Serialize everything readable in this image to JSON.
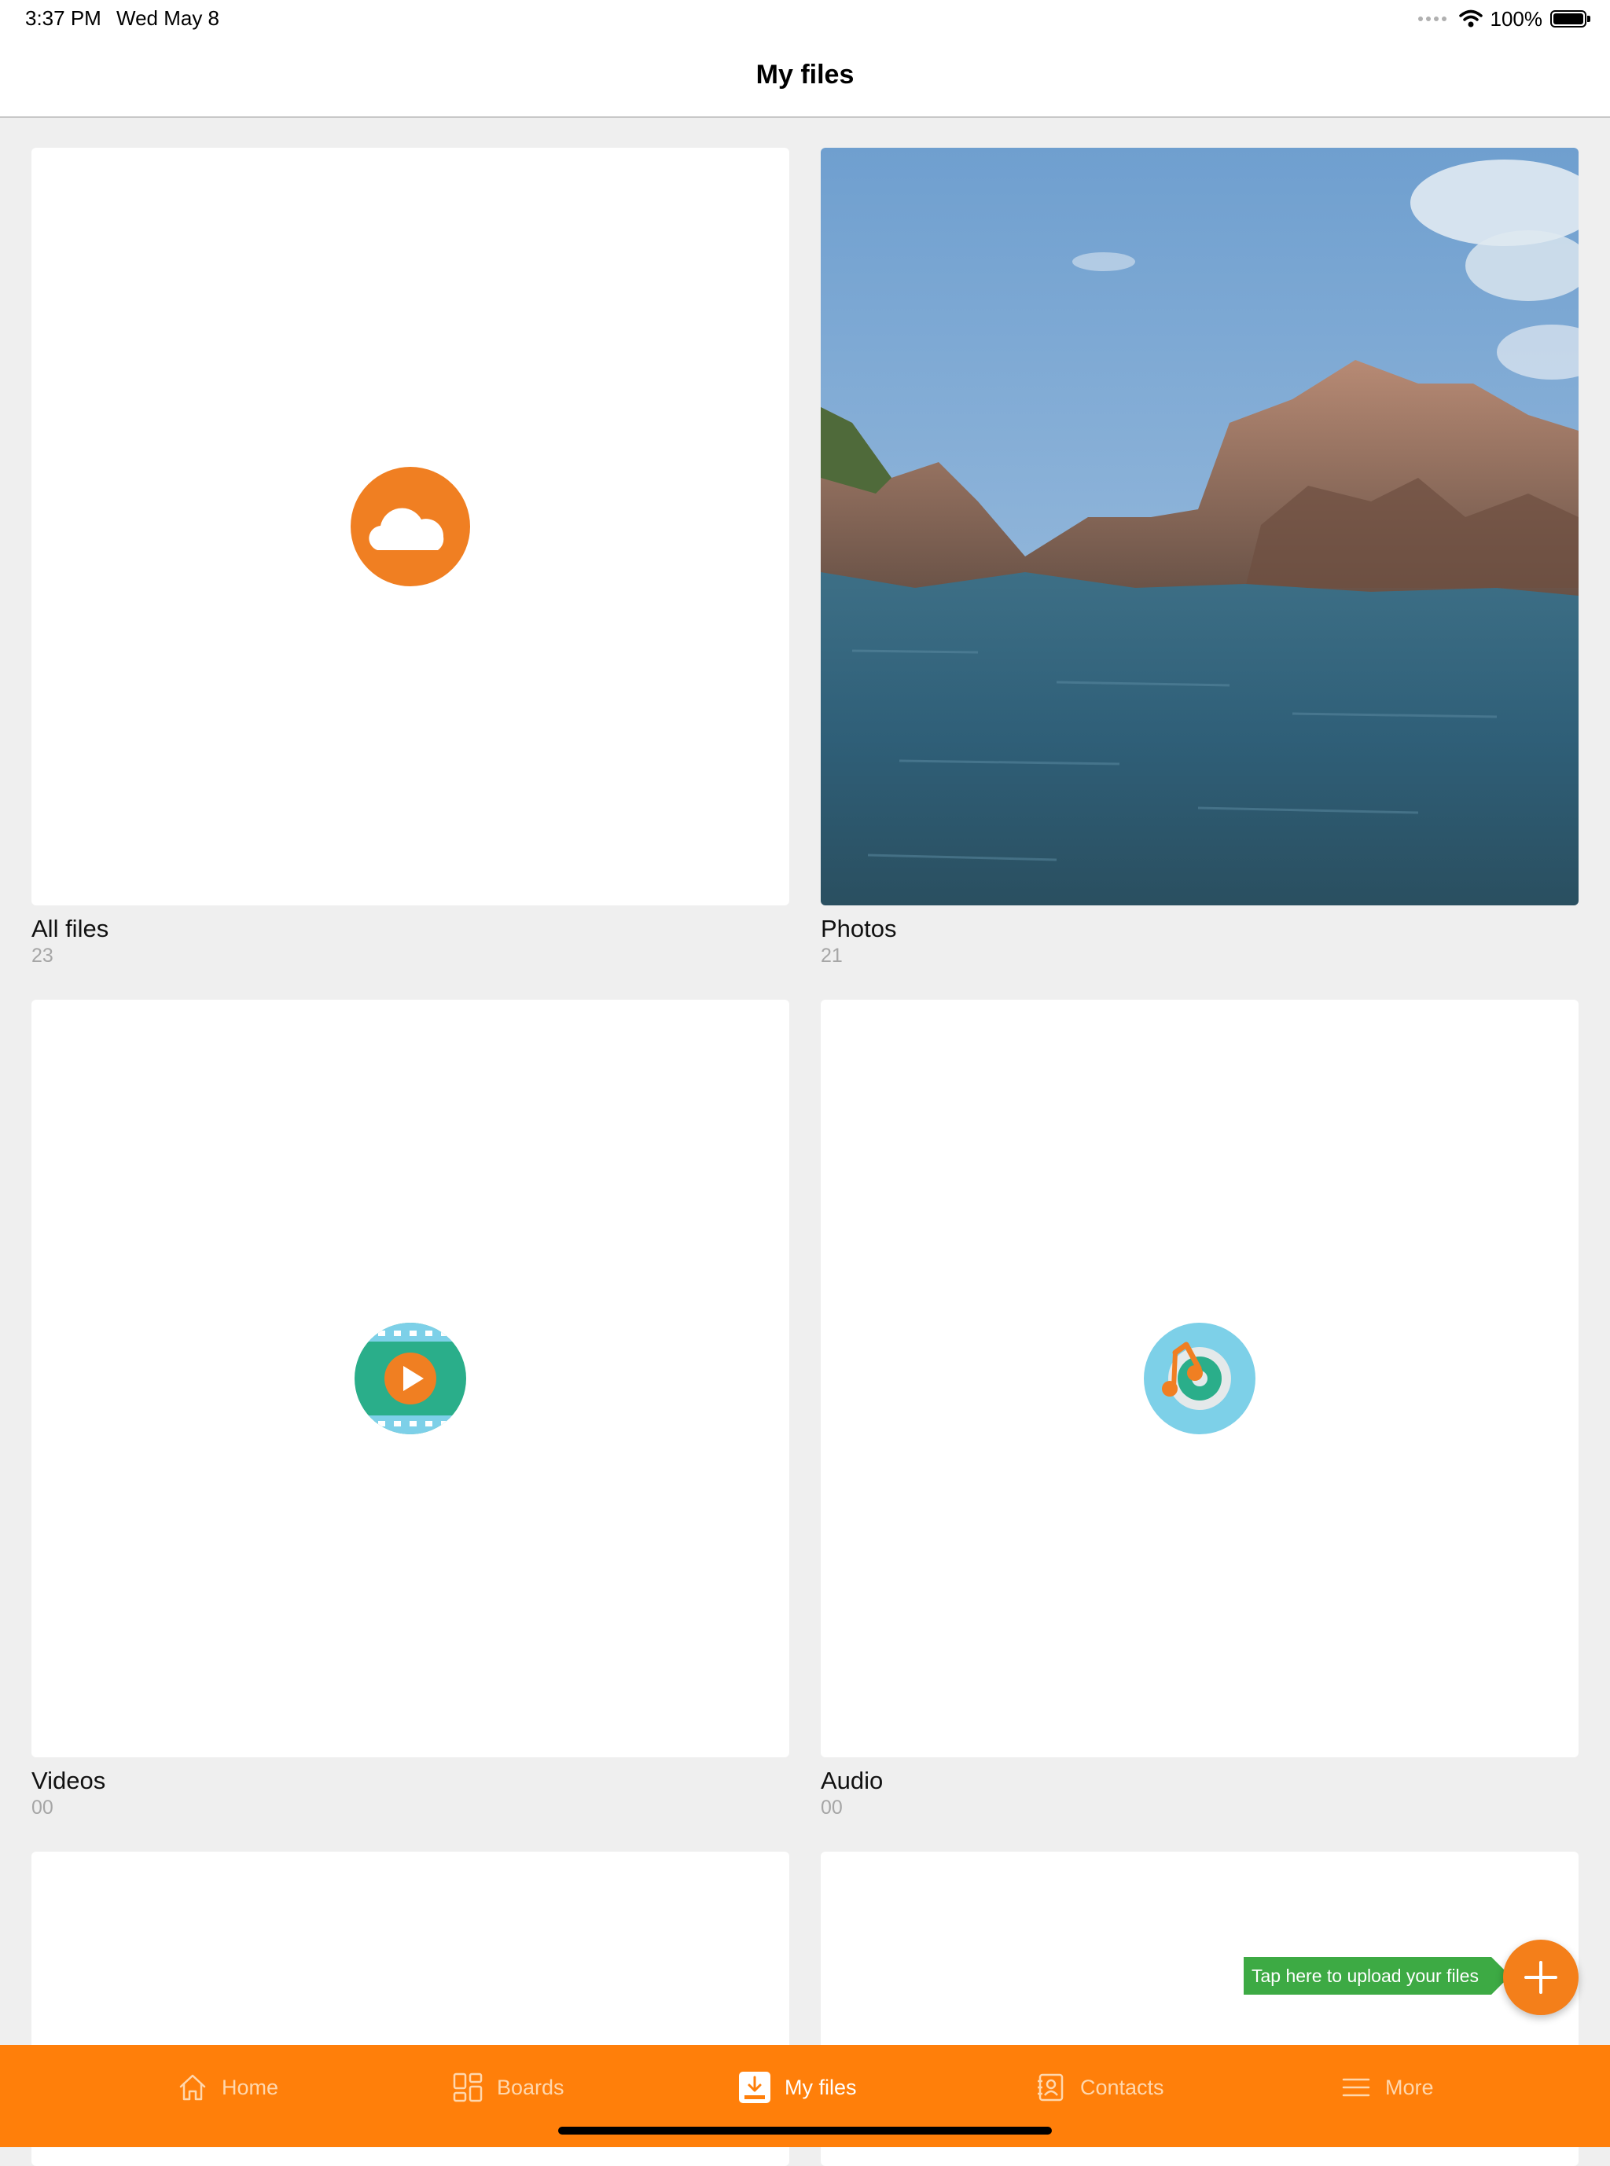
{
  "status_bar": {
    "time": "3:37 PM",
    "date": "Wed May 8",
    "battery": "100%"
  },
  "header": {
    "title": "My files"
  },
  "cards": [
    {
      "label": "All files",
      "count": "23",
      "icon": "cloud-icon"
    },
    {
      "label": "Photos",
      "count": "21",
      "icon": "photo-thumbnail"
    },
    {
      "label": "Videos",
      "count": "00",
      "icon": "video-film-icon"
    },
    {
      "label": "Audio",
      "count": "00",
      "icon": "audio-music-icon"
    }
  ],
  "upload": {
    "tooltip": "Tap here to upload your files",
    "icon": "plus-icon"
  },
  "tabs": [
    {
      "label": "Home",
      "icon": "home-icon"
    },
    {
      "label": "Boards",
      "icon": "boards-icon"
    },
    {
      "label": "My files",
      "icon": "download-tray-icon",
      "active": true
    },
    {
      "label": "Contacts",
      "icon": "contacts-icon"
    },
    {
      "label": "More",
      "icon": "menu-icon"
    }
  ],
  "colors": {
    "accent": "#ff7f0a",
    "fab": "#f47f1a",
    "tooltip": "#3daa44",
    "video_green": "#2aae8a",
    "audio_blue": "#7dd0e8"
  }
}
